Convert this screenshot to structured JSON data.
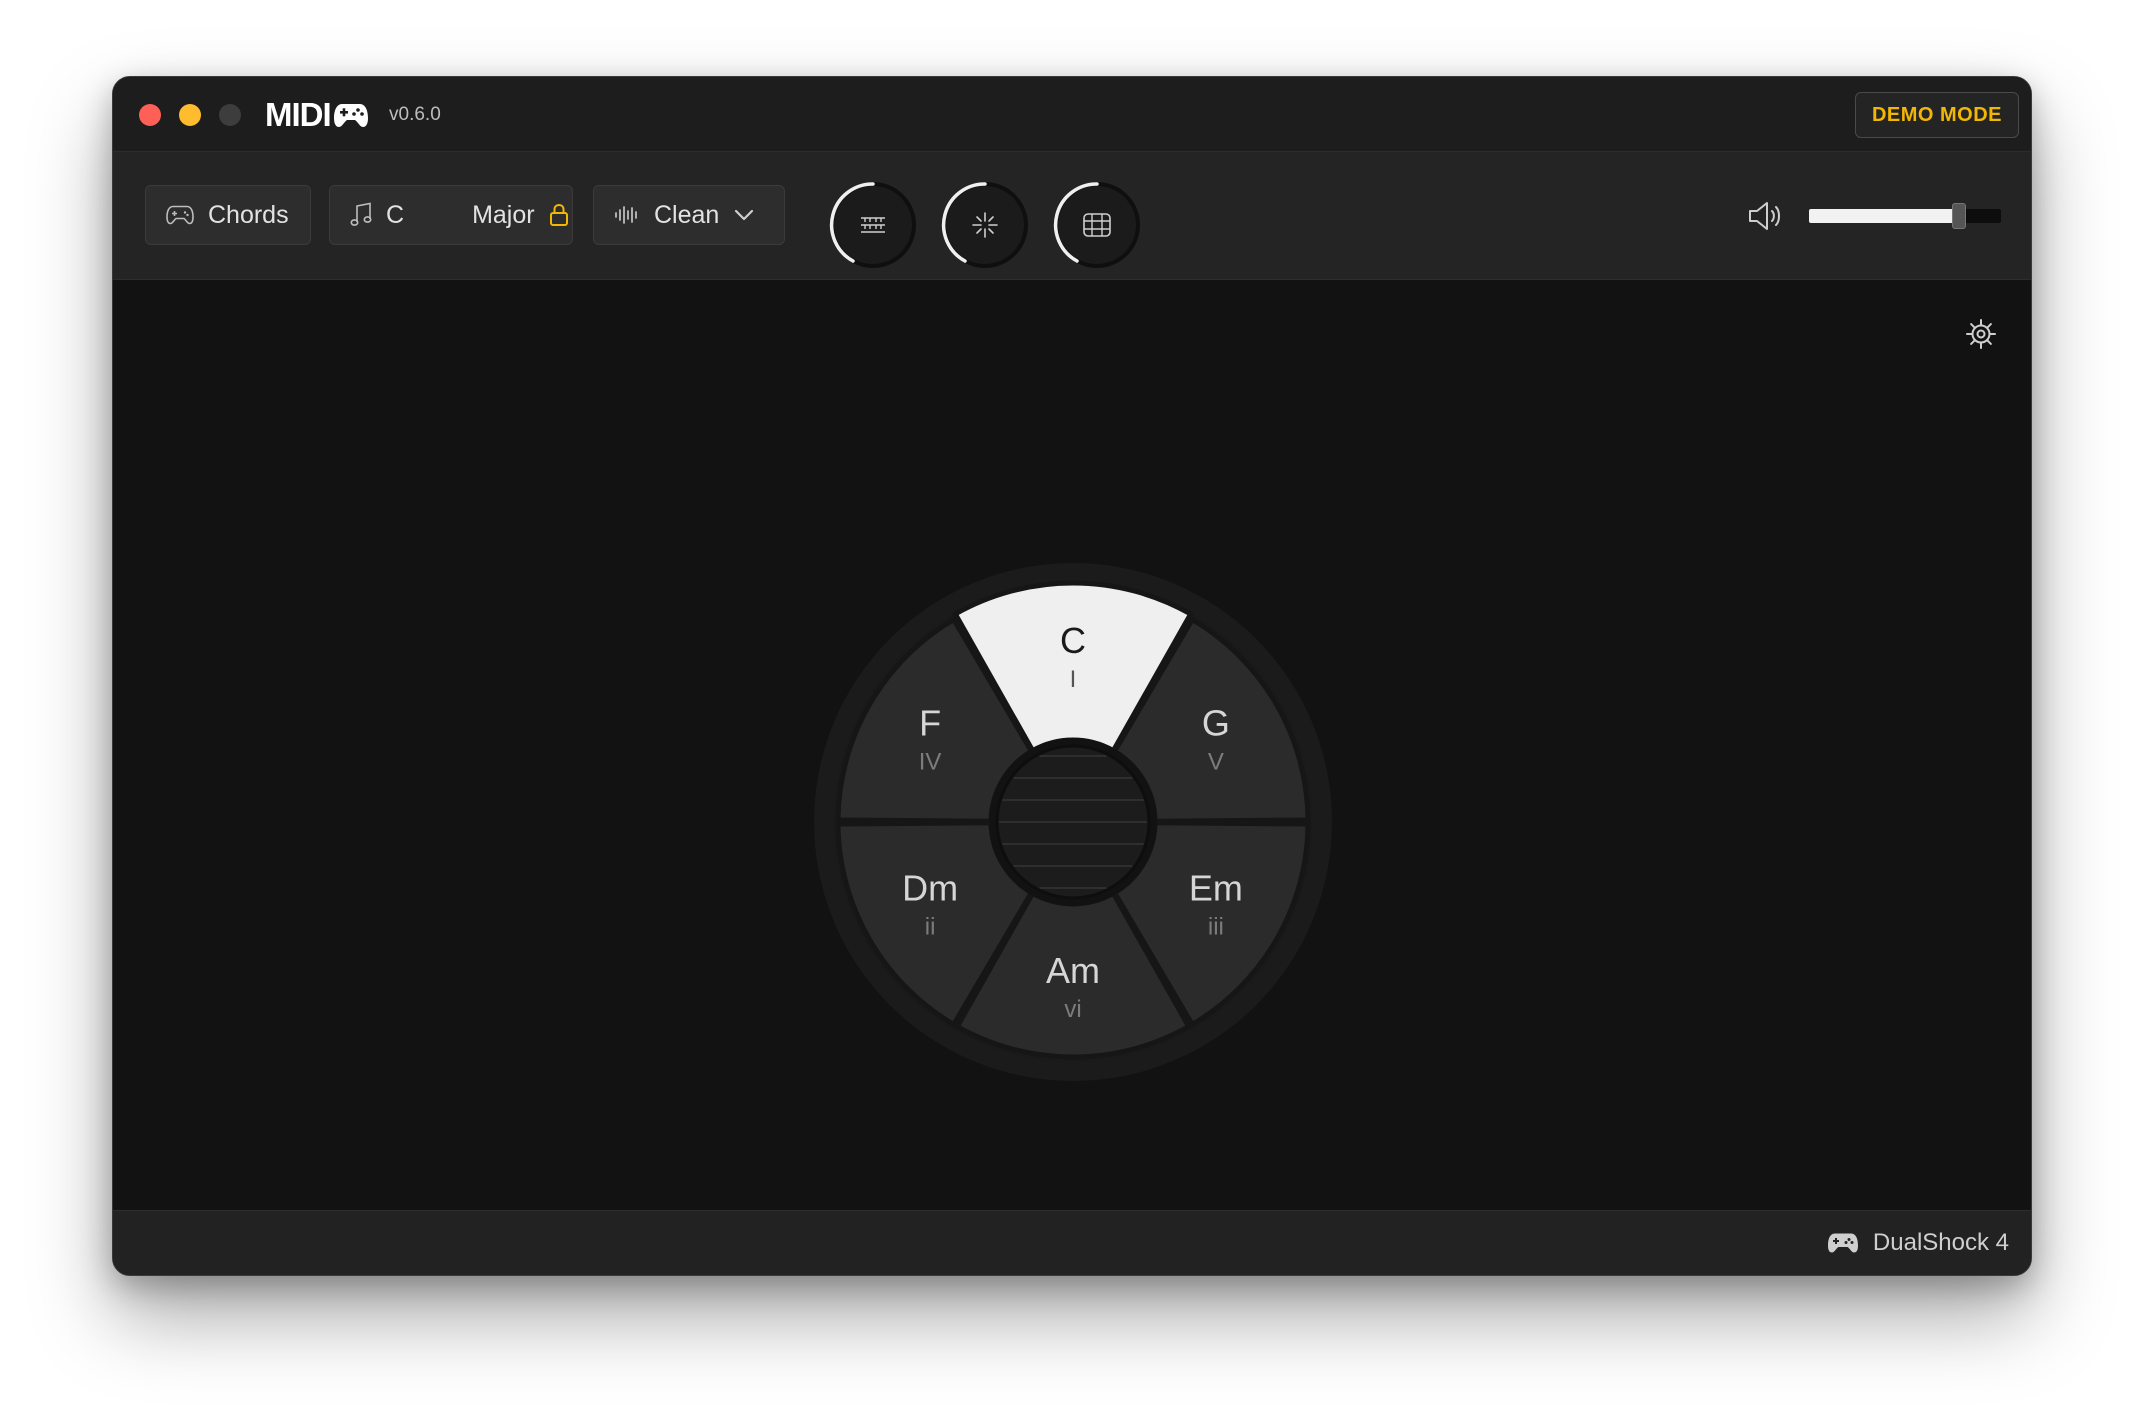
{
  "app": {
    "name": "MIDI",
    "version": "v0.6.0",
    "demo_badge": "DEMO MODE"
  },
  "toolbar": {
    "mode_label": "Chords",
    "key_label": "C",
    "scale_label": "Major",
    "sound_label": "Clean",
    "volume_level": 0.78
  },
  "wheel": {
    "active_chord": "C",
    "chords": [
      {
        "name": "C",
        "numeral": "I"
      },
      {
        "name": "G",
        "numeral": "V"
      },
      {
        "name": "Em",
        "numeral": "iii"
      },
      {
        "name": "Am",
        "numeral": "vi"
      },
      {
        "name": "Dm",
        "numeral": "ii"
      },
      {
        "name": "F",
        "numeral": "IV"
      }
    ]
  },
  "status": {
    "controller": "DualShock 4"
  },
  "colors": {
    "accent": "#f2b705",
    "active_segment": "#efefef",
    "segment": "#2b2b2b",
    "background": "#121212"
  }
}
